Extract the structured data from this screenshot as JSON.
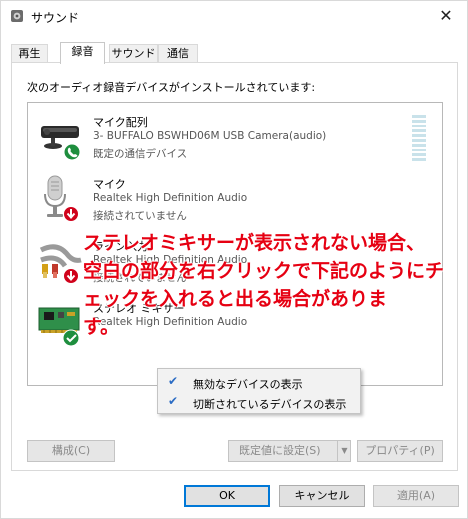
{
  "window": {
    "title": "サウンド",
    "close_glyph": "✕"
  },
  "tabs": [
    {
      "label": "再生",
      "active": false
    },
    {
      "label": "録音",
      "active": true
    },
    {
      "label": "サウンド",
      "active": false
    },
    {
      "label": "通信",
      "active": false
    }
  ],
  "panel": {
    "instruction": "次のオーディオ録音デバイスがインストールされています:"
  },
  "devices": [
    {
      "name": "マイク配列",
      "description": "3- BUFFALO BSWHD06M USB Camera(audio)",
      "status": "既定の通信デバイス",
      "icon": "webcam-icon",
      "badge": "phone-badge-icon"
    },
    {
      "name": "マイク",
      "description": "Realtek High Definition Audio",
      "status": "接続されていません",
      "icon": "microphone-icon",
      "badge": "disconnected-badge-icon"
    },
    {
      "name": "ライン入力",
      "description": "Realtek High Definition Audio",
      "status": "接続されていません",
      "icon": "line-in-cable-icon",
      "badge": "disconnected-badge-icon"
    },
    {
      "name": "ステレオ ミキサー",
      "description": "Realtek High Definition Audio",
      "status": "",
      "icon": "sound-card-icon",
      "badge": "ok-badge-icon"
    }
  ],
  "annotation": {
    "line1": "ステレオミキサーが表示されない場合、",
    "line2": "空白の部分を右クリックで下記のようにチ",
    "line3": "ェックを入れると出る場合がありま",
    "line4": "す。",
    "color": "#e60012"
  },
  "context_menu": {
    "items": [
      {
        "label": "無効なデバイスの表示",
        "checked": true
      },
      {
        "label": "切断されているデバイスの表示",
        "checked": true
      }
    ],
    "check_glyph": "✔"
  },
  "panel_buttons": {
    "configure": "構成(C)",
    "set_default": "既定値に設定(S)",
    "set_default_arrow": "▼",
    "properties": "プロパティ(P)"
  },
  "dialog_buttons": {
    "ok": "OK",
    "cancel": "キャンセル",
    "apply": "適用(A)"
  },
  "colors": {
    "accent": "#0078d7",
    "level_meter": "#c9e2ea",
    "check": "#2b6cc4"
  }
}
